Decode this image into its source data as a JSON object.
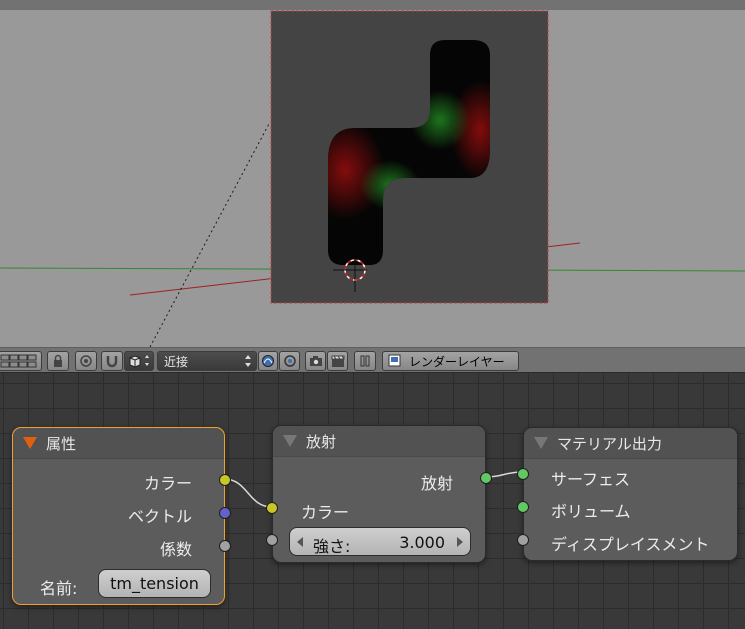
{
  "viewport": {
    "background": "#999999"
  },
  "header": {
    "proportional_mode": "近接",
    "render_layer_label": "レンダーレイヤー"
  },
  "nodes": {
    "attribute": {
      "title": "属性",
      "outputs": [
        "カラー",
        "ベクトル",
        "係数"
      ],
      "name_label": "名前:",
      "name_value": "tm_tension"
    },
    "emission": {
      "title": "放射",
      "output": "放射",
      "input_color": "カラー",
      "strength_label": "強さ:",
      "strength_value": "3.000"
    },
    "material_output": {
      "title": "マテリアル出力",
      "inputs": [
        "サーフェス",
        "ボリューム",
        "ディスプレイスメント"
      ]
    }
  },
  "colors": {
    "socket_color": "#c7c72a",
    "socket_vector": "#6363c7",
    "socket_float": "#a1a1a1",
    "socket_shader": "#63c763",
    "active_node_border": "#f0a030"
  }
}
